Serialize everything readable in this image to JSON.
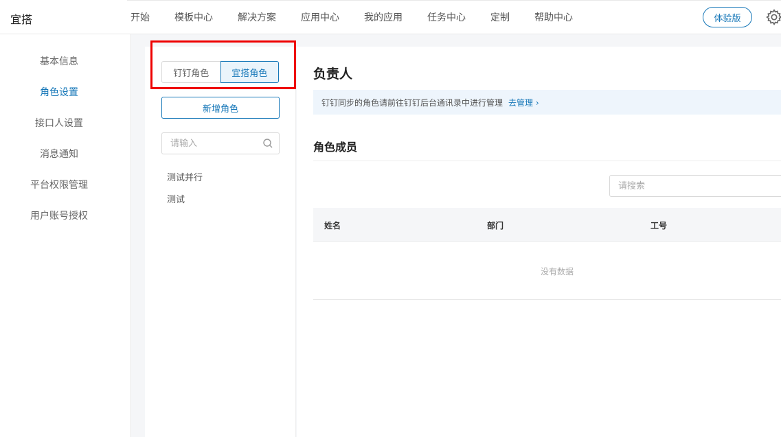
{
  "header": {
    "logo": "宜搭",
    "nav": [
      "开始",
      "模板中心",
      "解决方案",
      "应用中心",
      "我的应用",
      "任务中心",
      "定制",
      "帮助中心"
    ],
    "trial_label": "体验版",
    "settings_icon": "gear-icon"
  },
  "sidebar": {
    "items": [
      "基本信息",
      "角色设置",
      "接口人设置",
      "消息通知",
      "平台权限管理",
      "用户账号授权"
    ],
    "active_index": 1,
    "accent_color": "#1677b8"
  },
  "roles": {
    "tabs": [
      "钉钉角色",
      "宜搭角色"
    ],
    "active_tab": 1,
    "add_label": "新增角色",
    "search_placeholder": "请输入",
    "search_icon": "search-icon",
    "items": [
      "测试并行",
      "测试"
    ]
  },
  "detail": {
    "title": "负责人",
    "info_text": "钉钉同步的角色请前往钉钉后台通讯录中进行管理",
    "info_link": "去管理 ›",
    "members_title": "角色成员",
    "search_placeholder": "请搜索",
    "columns": [
      "姓名",
      "部门",
      "工号"
    ],
    "empty_text": "没有数据"
  },
  "highlight_color": "#ee0000"
}
